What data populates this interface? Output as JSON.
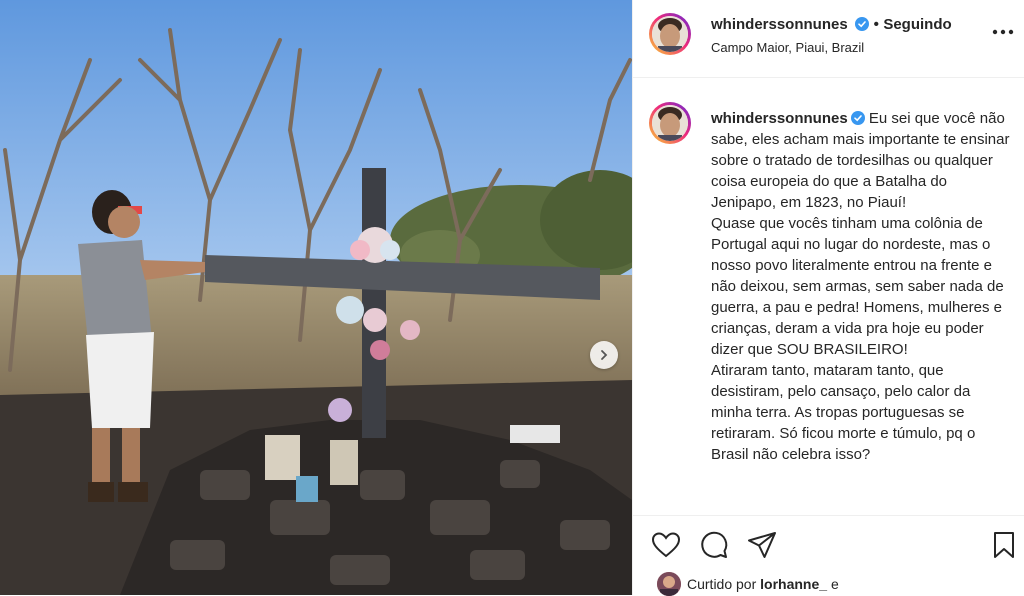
{
  "post": {
    "image_alt": "",
    "carousel_next_icon": "chevron-right-icon"
  },
  "header": {
    "username": "whinderssonnunes",
    "verified_icon": "verified-badge-icon",
    "separator": "•",
    "follow_status": "Seguindo",
    "location": "Campo Maior, Piaui, Brazil",
    "more_icon": "more-options-icon"
  },
  "caption": {
    "username": "whinderssonnunes",
    "text": "Eu sei que você não sabe, eles acham mais importante te ensinar sobre o tratado de tordesilhas ou qualquer coisa europeia do que a Batalha do Jenipapo, em 1823, no Piauí!\nQuase que vocês tinham uma colônia de Portugal aqui no lugar do nordeste, mas o nosso povo literalmente entrou na frente e não deixou, sem armas, sem saber nada de guerra, a pau e pedra! Homens, mulheres e crianças, deram a vida pra hoje eu poder dizer que SOU BRASILEIRO!\nAtiraram tanto, mataram tanto, que desistiram, pelo cansaço, pelo calor da minha terra. As tropas portuguesas se retiraram. Só ficou morte e túmulo, pq o Brasil não celebra isso?"
  },
  "actions": {
    "like_icon": "heart-icon",
    "comment_icon": "comment-icon",
    "share_icon": "share-icon",
    "save_icon": "bookmark-icon",
    "liked_by_prefix": "Curtido por",
    "liked_by_user": "lorhanne_",
    "liked_by_suffix": "e"
  },
  "colors": {
    "verified": "#3897f0",
    "text": "#262626",
    "avatar_ring_start": "#f9ce34",
    "avatar_ring_end": "#ee2a7b"
  }
}
